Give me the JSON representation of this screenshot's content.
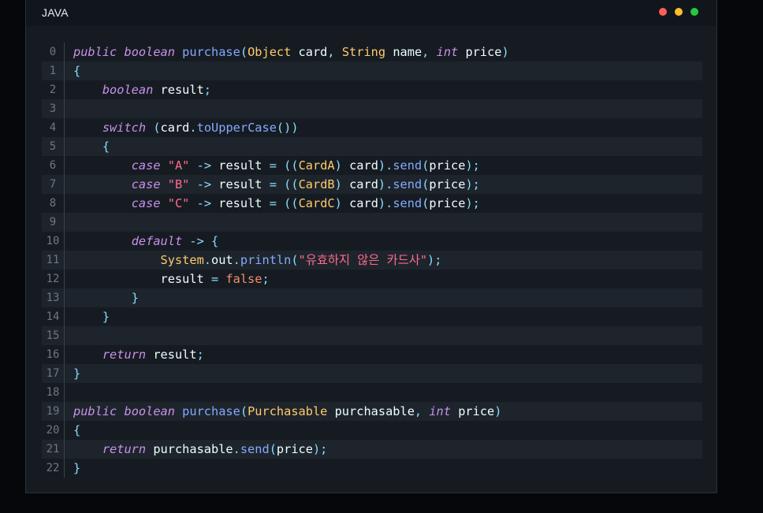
{
  "header": {
    "language": "JAVA",
    "colors": {
      "red": "#ff5f57",
      "yellow": "#febc2e",
      "green": "#28c840"
    }
  },
  "token_colors": {
    "kw": "#c792ea",
    "fn": "#82aaff",
    "type": "#ffcb6b",
    "str": "#ff6b8b",
    "punct": "#89ddff",
    "plain": "#eeffff",
    "const": "#f78c6c"
  },
  "lines": [
    {
      "n": "0",
      "tokens": [
        [
          "kw",
          "public"
        ],
        [
          "plain",
          " "
        ],
        [
          "kw",
          "boolean"
        ],
        [
          "plain",
          " "
        ],
        [
          "fn",
          "purchase"
        ],
        [
          "punct",
          "("
        ],
        [
          "type",
          "Object"
        ],
        [
          "plain",
          " card"
        ],
        [
          "punct",
          ","
        ],
        [
          "plain",
          " "
        ],
        [
          "type",
          "String"
        ],
        [
          "plain",
          " name"
        ],
        [
          "punct",
          ","
        ],
        [
          "plain",
          " "
        ],
        [
          "kw",
          "int"
        ],
        [
          "plain",
          " price"
        ],
        [
          "punct",
          ")"
        ]
      ]
    },
    {
      "n": "1",
      "tokens": [
        [
          "punct",
          "{"
        ]
      ]
    },
    {
      "n": "2",
      "tokens": [
        [
          "plain",
          "    "
        ],
        [
          "kw",
          "boolean"
        ],
        [
          "plain",
          " result"
        ],
        [
          "punct",
          ";"
        ]
      ]
    },
    {
      "n": "3",
      "tokens": []
    },
    {
      "n": "4",
      "tokens": [
        [
          "plain",
          "    "
        ],
        [
          "kw",
          "switch"
        ],
        [
          "plain",
          " "
        ],
        [
          "punct",
          "("
        ],
        [
          "plain",
          "card"
        ],
        [
          "punct",
          "."
        ],
        [
          "fn",
          "toUpperCase"
        ],
        [
          "punct",
          "())"
        ]
      ]
    },
    {
      "n": "5",
      "tokens": [
        [
          "plain",
          "    "
        ],
        [
          "punct",
          "{"
        ]
      ]
    },
    {
      "n": "6",
      "tokens": [
        [
          "plain",
          "        "
        ],
        [
          "kw",
          "case"
        ],
        [
          "plain",
          " "
        ],
        [
          "str",
          "\"A\""
        ],
        [
          "plain",
          " "
        ],
        [
          "punct",
          "->"
        ],
        [
          "plain",
          " result "
        ],
        [
          "punct",
          "="
        ],
        [
          "plain",
          " "
        ],
        [
          "punct",
          "(("
        ],
        [
          "type",
          "CardA"
        ],
        [
          "punct",
          ")"
        ],
        [
          "plain",
          " card"
        ],
        [
          "punct",
          ")."
        ],
        [
          "fn",
          "send"
        ],
        [
          "punct",
          "("
        ],
        [
          "plain",
          "price"
        ],
        [
          "punct",
          ");"
        ]
      ]
    },
    {
      "n": "7",
      "tokens": [
        [
          "plain",
          "        "
        ],
        [
          "kw",
          "case"
        ],
        [
          "plain",
          " "
        ],
        [
          "str",
          "\"B\""
        ],
        [
          "plain",
          " "
        ],
        [
          "punct",
          "->"
        ],
        [
          "plain",
          " result "
        ],
        [
          "punct",
          "="
        ],
        [
          "plain",
          " "
        ],
        [
          "punct",
          "(("
        ],
        [
          "type",
          "CardB"
        ],
        [
          "punct",
          ")"
        ],
        [
          "plain",
          " card"
        ],
        [
          "punct",
          ")."
        ],
        [
          "fn",
          "send"
        ],
        [
          "punct",
          "("
        ],
        [
          "plain",
          "price"
        ],
        [
          "punct",
          ");"
        ]
      ]
    },
    {
      "n": "8",
      "tokens": [
        [
          "plain",
          "        "
        ],
        [
          "kw",
          "case"
        ],
        [
          "plain",
          " "
        ],
        [
          "str",
          "\"C\""
        ],
        [
          "plain",
          " "
        ],
        [
          "punct",
          "->"
        ],
        [
          "plain",
          " result "
        ],
        [
          "punct",
          "="
        ],
        [
          "plain",
          " "
        ],
        [
          "punct",
          "(("
        ],
        [
          "type",
          "CardC"
        ],
        [
          "punct",
          ")"
        ],
        [
          "plain",
          " card"
        ],
        [
          "punct",
          ")."
        ],
        [
          "fn",
          "send"
        ],
        [
          "punct",
          "("
        ],
        [
          "plain",
          "price"
        ],
        [
          "punct",
          ");"
        ]
      ]
    },
    {
      "n": "9",
      "tokens": []
    },
    {
      "n": "10",
      "tokens": [
        [
          "plain",
          "        "
        ],
        [
          "kw",
          "default"
        ],
        [
          "plain",
          " "
        ],
        [
          "punct",
          "->"
        ],
        [
          "plain",
          " "
        ],
        [
          "punct",
          "{"
        ]
      ]
    },
    {
      "n": "11",
      "tokens": [
        [
          "plain",
          "            "
        ],
        [
          "type",
          "System"
        ],
        [
          "punct",
          "."
        ],
        [
          "plain",
          "out"
        ],
        [
          "punct",
          "."
        ],
        [
          "fn",
          "println"
        ],
        [
          "punct",
          "("
        ],
        [
          "str",
          "\"유효하지 않은 카드사\""
        ],
        [
          "punct",
          ");"
        ]
      ]
    },
    {
      "n": "12",
      "tokens": [
        [
          "plain",
          "            result "
        ],
        [
          "punct",
          "="
        ],
        [
          "plain",
          " "
        ],
        [
          "const",
          "false"
        ],
        [
          "punct",
          ";"
        ]
      ]
    },
    {
      "n": "13",
      "tokens": [
        [
          "plain",
          "        "
        ],
        [
          "punct",
          "}"
        ]
      ]
    },
    {
      "n": "14",
      "tokens": [
        [
          "plain",
          "    "
        ],
        [
          "punct",
          "}"
        ]
      ]
    },
    {
      "n": "15",
      "tokens": []
    },
    {
      "n": "16",
      "tokens": [
        [
          "plain",
          "    "
        ],
        [
          "kw",
          "return"
        ],
        [
          "plain",
          " result"
        ],
        [
          "punct",
          ";"
        ]
      ]
    },
    {
      "n": "17",
      "tokens": [
        [
          "punct",
          "}"
        ]
      ]
    },
    {
      "n": "18",
      "tokens": []
    },
    {
      "n": "19",
      "tokens": [
        [
          "kw",
          "public"
        ],
        [
          "plain",
          " "
        ],
        [
          "kw",
          "boolean"
        ],
        [
          "plain",
          " "
        ],
        [
          "fn",
          "purchase"
        ],
        [
          "punct",
          "("
        ],
        [
          "type",
          "Purchasable"
        ],
        [
          "plain",
          " purchasable"
        ],
        [
          "punct",
          ","
        ],
        [
          "plain",
          " "
        ],
        [
          "kw",
          "int"
        ],
        [
          "plain",
          " price"
        ],
        [
          "punct",
          ")"
        ]
      ]
    },
    {
      "n": "20",
      "tokens": [
        [
          "punct",
          "{"
        ]
      ]
    },
    {
      "n": "21",
      "tokens": [
        [
          "plain",
          "    "
        ],
        [
          "kw",
          "return"
        ],
        [
          "plain",
          " purchasable"
        ],
        [
          "punct",
          "."
        ],
        [
          "fn",
          "send"
        ],
        [
          "punct",
          "("
        ],
        [
          "plain",
          "price"
        ],
        [
          "punct",
          ");"
        ]
      ]
    },
    {
      "n": "22",
      "tokens": [
        [
          "punct",
          "}"
        ]
      ]
    }
  ]
}
